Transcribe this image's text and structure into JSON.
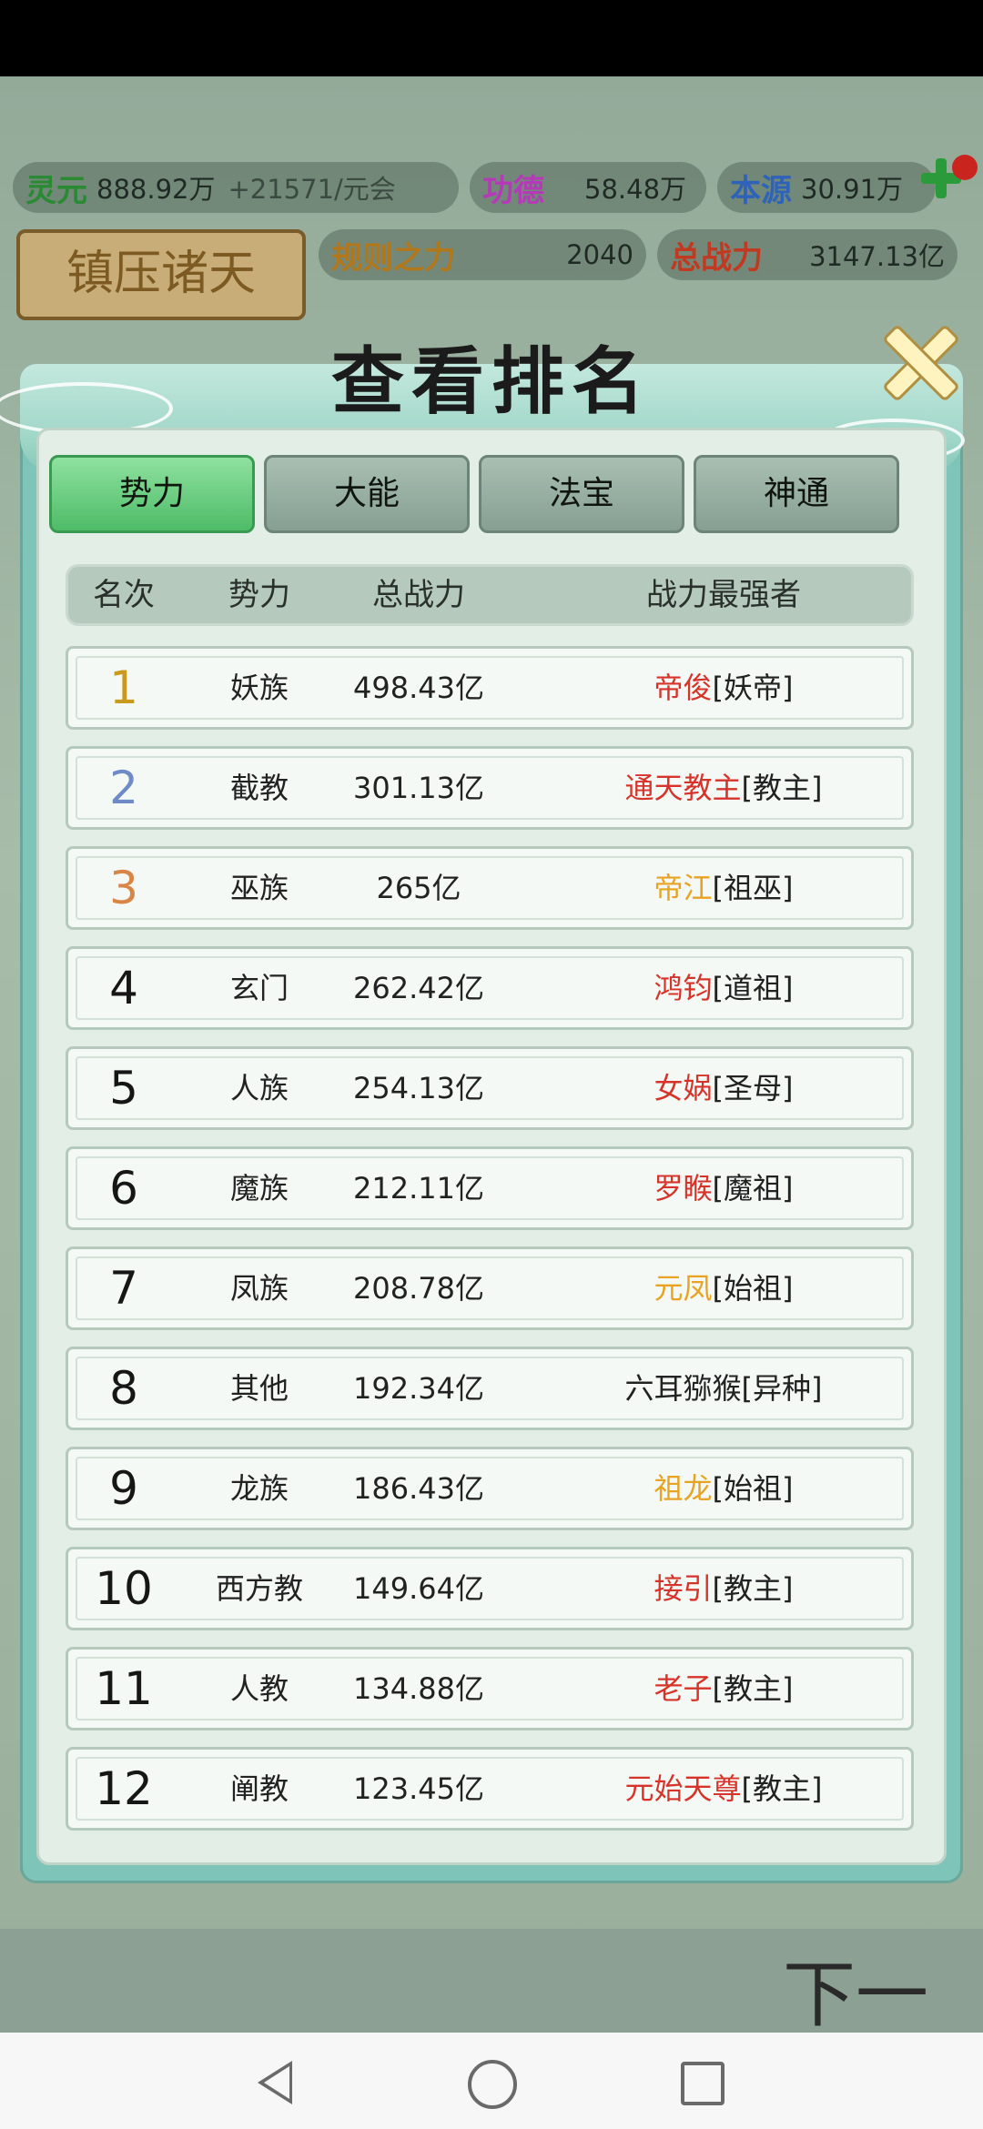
{
  "resources": {
    "lingyuan": {
      "name": "灵元",
      "value": "888.92万",
      "rate": "+21571/元会"
    },
    "gongde": {
      "name": "功德",
      "value": "58.48万"
    },
    "benyuan": {
      "name": "本源",
      "value": "30.91万"
    },
    "guize": {
      "name": "规则之力",
      "value": "2040"
    },
    "zhanli": {
      "name": "总战力",
      "value": "3147.13亿"
    }
  },
  "banner": "镇压诸天",
  "modal": {
    "title": "查看排名",
    "tabs": [
      {
        "label": "势力",
        "active": true
      },
      {
        "label": "大能",
        "active": false
      },
      {
        "label": "法宝",
        "active": false
      },
      {
        "label": "神通",
        "active": false
      }
    ],
    "columns": {
      "rank": "名次",
      "faction": "势力",
      "power": "总战力",
      "strongest": "战力最强者"
    },
    "rows": [
      {
        "rank": "1",
        "faction": "妖族",
        "power": "498.43亿",
        "name": "帝俊",
        "title": "[妖帝]",
        "color": "#d6342a"
      },
      {
        "rank": "2",
        "faction": "截教",
        "power": "301.13亿",
        "name": "通天教主",
        "title": "[教主]",
        "color": "#d6342a"
      },
      {
        "rank": "3",
        "faction": "巫族",
        "power": "265亿",
        "name": "帝江",
        "title": "[祖巫]",
        "color": "#e8a322"
      },
      {
        "rank": "4",
        "faction": "玄门",
        "power": "262.42亿",
        "name": "鸿钧",
        "title": "[道祖]",
        "color": "#d6342a"
      },
      {
        "rank": "5",
        "faction": "人族",
        "power": "254.13亿",
        "name": "女娲",
        "title": "[圣母]",
        "color": "#d6342a"
      },
      {
        "rank": "6",
        "faction": "魔族",
        "power": "212.11亿",
        "name": "罗睺",
        "title": "[魔祖]",
        "color": "#d6342a"
      },
      {
        "rank": "7",
        "faction": "凤族",
        "power": "208.78亿",
        "name": "元凤",
        "title": "[始祖]",
        "color": "#e8a322"
      },
      {
        "rank": "8",
        "faction": "其他",
        "power": "192.34亿",
        "name": "六耳猕猴",
        "title": "[异种]",
        "color": "#222222"
      },
      {
        "rank": "9",
        "faction": "龙族",
        "power": "186.43亿",
        "name": "祖龙",
        "title": "[始祖]",
        "color": "#e8a322"
      },
      {
        "rank": "10",
        "faction": "西方教",
        "power": "149.64亿",
        "name": "接引",
        "title": "[教主]",
        "color": "#d6342a"
      },
      {
        "rank": "11",
        "faction": "人教",
        "power": "134.88亿",
        "name": "老子",
        "title": "[教主]",
        "color": "#d6342a"
      },
      {
        "rank": "12",
        "faction": "阐教",
        "power": "123.45亿",
        "name": "元始天尊",
        "title": "[教主]",
        "color": "#d6342a"
      }
    ]
  },
  "next_label": "下一"
}
